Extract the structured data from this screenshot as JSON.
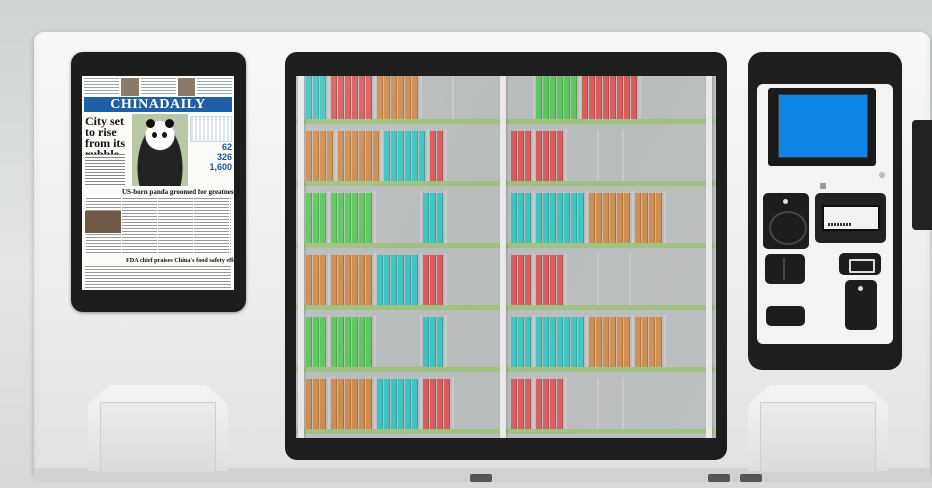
{
  "newspaper": {
    "masthead": "CHINADAILY",
    "headline": "City set to rise from its rubble",
    "stat_1": "62",
    "stat_2": "326",
    "stat_3": "1,600",
    "subheadline": "US-born panda groomed for greatness",
    "subheadline_2": "FDA chief praises China's food safety effort"
  },
  "colors": {
    "book_teal": "#3fc3c0",
    "book_red": "#d85c5c",
    "book_orange": "#cf8c4c",
    "book_green": "#5cc75c",
    "shelf_green": "#9fc07f",
    "screen_blue": "#0d86e8",
    "frame_black": "#1e1e1e"
  },
  "icons": {
    "touch_screen": "touchscreen",
    "card_reader": "card-reader-icon",
    "printer": "receipt-printer-icon",
    "usb": "usb-port-icon",
    "scanner": "barcode-scanner-icon",
    "coin_slot": "coin-slot-icon",
    "cash_slot": "cash-slot-icon"
  }
}
